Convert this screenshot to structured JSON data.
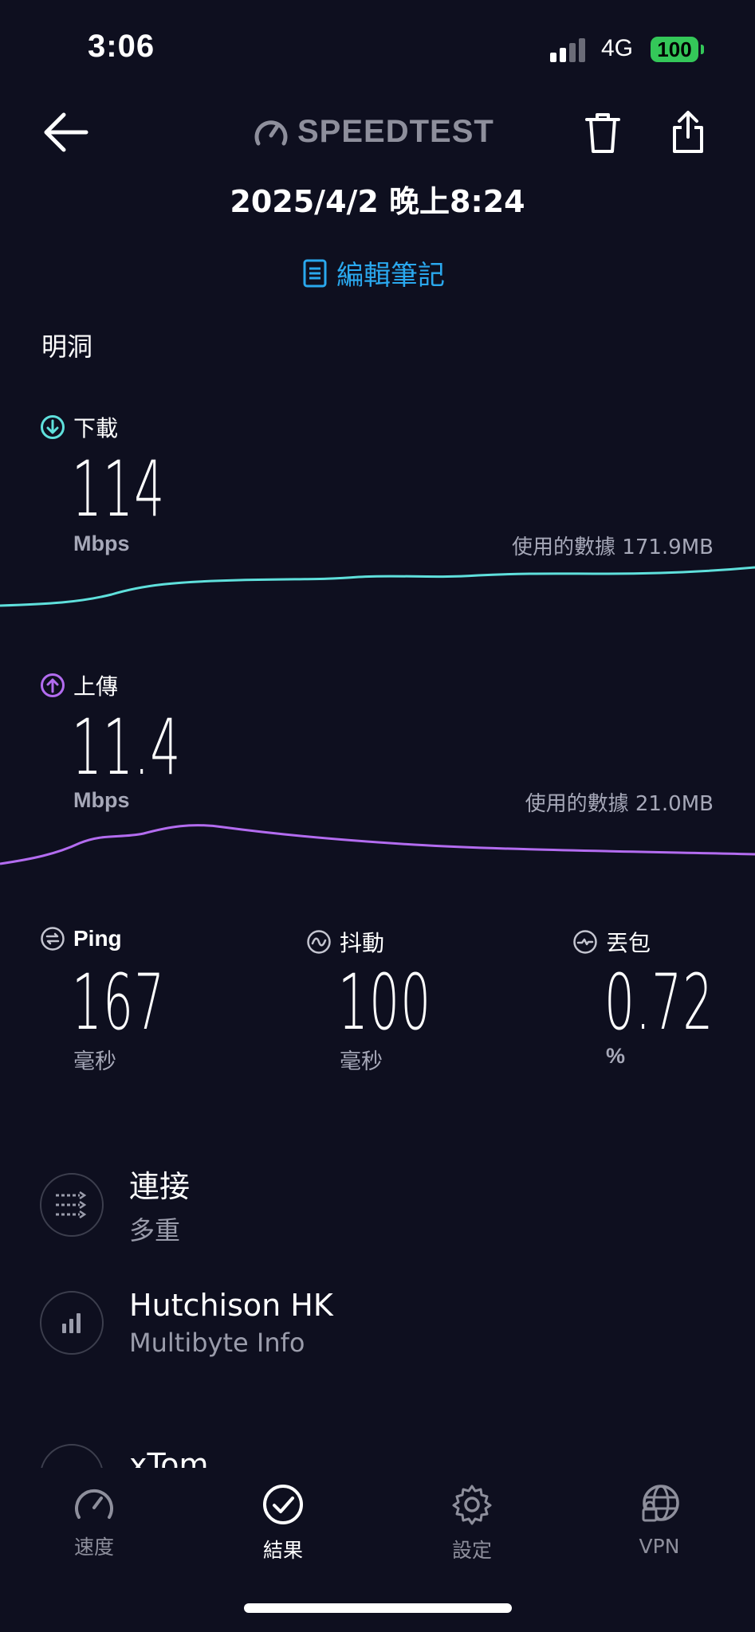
{
  "status_bar": {
    "time": "3:06",
    "network": "4G",
    "battery": "100"
  },
  "header": {
    "logo": "SPEEDTEST",
    "datetime": "2025/4/2 晚上8:24",
    "edit_note": "編輯筆記"
  },
  "location": "明洞",
  "download": {
    "label": "下載",
    "value": "114",
    "unit": "Mbps",
    "data_used": "使用的數據 171.9MB",
    "color": "#5fe0dc"
  },
  "upload": {
    "label": "上傳",
    "value": "11.4",
    "unit": "Mbps",
    "data_used": "使用的數據 21.0MB",
    "color": "#b36cf0"
  },
  "stats": [
    {
      "label": "Ping",
      "value": "167",
      "unit": "毫秒"
    },
    {
      "label": "抖動",
      "value": "100",
      "unit": "毫秒"
    },
    {
      "label": "丟包",
      "value": "0.72",
      "unit": "%"
    }
  ],
  "details": [
    {
      "title": "連接",
      "subtitle": "多重",
      "icon": "connections-icon"
    },
    {
      "title": "Hutchison HK",
      "subtitle": "Multibyte Info",
      "icon": "signal-bars-icon"
    },
    {
      "title": "xTom",
      "subtitle": "",
      "icon": "server-icon"
    }
  ],
  "tabs": [
    {
      "label": "速度",
      "icon": "speedometer-icon",
      "active": false
    },
    {
      "label": "結果",
      "icon": "checkmark-circle-icon",
      "active": true
    },
    {
      "label": "設定",
      "icon": "gear-icon",
      "active": false
    },
    {
      "label": "VPN",
      "icon": "vpn-globe-icon",
      "active": false
    }
  ]
}
